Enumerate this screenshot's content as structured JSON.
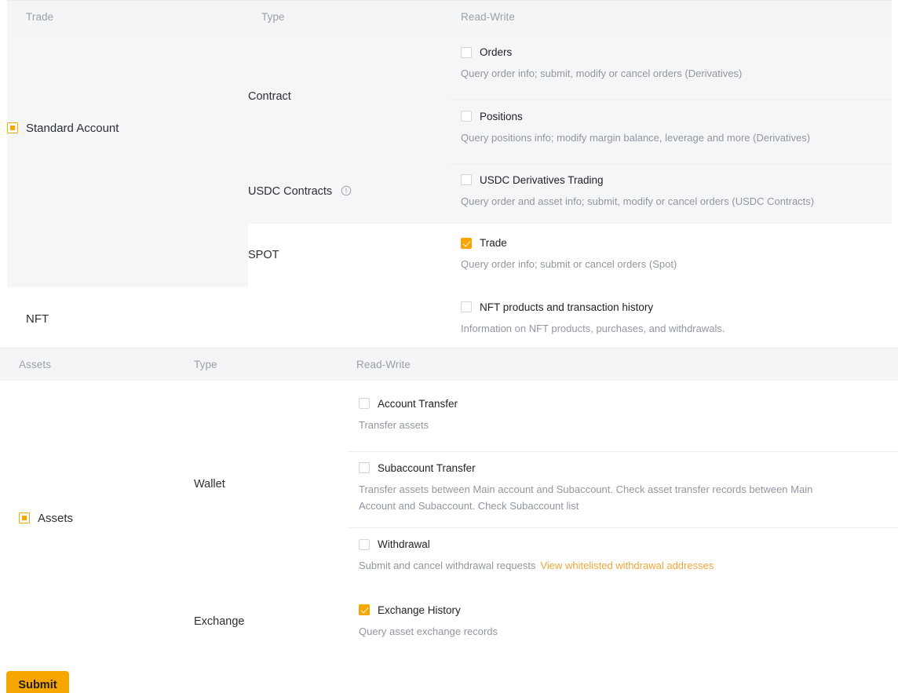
{
  "colors": {
    "accent": "#f7a600",
    "link": "#f0a53b",
    "header_bg": "#f4f5f7",
    "shaded_row_bg": "#f5f6f8",
    "border": "#edeef1",
    "label_text": "#2b2f36",
    "muted_text": "#9096a0"
  },
  "trade_table": {
    "headers": {
      "col1": "Trade",
      "col2": "Type",
      "col3": "Read-Write"
    },
    "groups": [
      {
        "name": "Standard Account",
        "checkbox_state": "indeterminate",
        "types": [
          {
            "type_label": "Contract",
            "has_info_icon": false,
            "permissions": [
              {
                "label": "Orders",
                "checked": false,
                "description": "Query order info; submit, modify or cancel orders (Derivatives)"
              },
              {
                "label": "Positions",
                "checked": false,
                "description": "Query positions info; modify margin balance, leverage and more (Derivatives)"
              }
            ]
          },
          {
            "type_label": "USDC Contracts",
            "has_info_icon": true,
            "info_icon_name": "info-circle-icon",
            "permissions": [
              {
                "label": "USDC Derivatives Trading",
                "checked": false,
                "description": "Query order and asset info; submit, modify or cancel orders (USDC Contracts)"
              }
            ]
          },
          {
            "type_label": "SPOT",
            "has_info_icon": false,
            "permissions": [
              {
                "label": "Trade",
                "checked": true,
                "description": "Query order info; submit or cancel orders (Spot)"
              }
            ]
          }
        ]
      },
      {
        "name": "NFT",
        "checkbox_state": "none",
        "types": [
          {
            "type_label": "",
            "has_info_icon": false,
            "permissions": [
              {
                "label": "NFT products and transaction history",
                "checked": false,
                "description": "Information on NFT products, purchases, and withdrawals."
              }
            ]
          }
        ]
      }
    ]
  },
  "assets_table": {
    "headers": {
      "col1": "Assets",
      "col2": "Type",
      "col3": "Read-Write"
    },
    "group": {
      "name": "Assets",
      "checkbox_state": "indeterminate"
    },
    "types": [
      {
        "type_label": "Wallet",
        "permissions": [
          {
            "label": "Account Transfer",
            "checked": false,
            "description": "Transfer assets",
            "link": ""
          },
          {
            "label": "Subaccount Transfer",
            "checked": false,
            "description": "Transfer assets between Main account and Subaccount. Check asset transfer records between Main Account and Subaccount. Check Subaccount list",
            "link": ""
          },
          {
            "label": "Withdrawal",
            "checked": false,
            "description": "Submit and cancel withdrawal requests",
            "link": "View whitelisted withdrawal addresses"
          }
        ]
      },
      {
        "type_label": "Exchange",
        "permissions": [
          {
            "label": "Exchange History",
            "checked": true,
            "description": "Query asset exchange records",
            "link": ""
          }
        ]
      }
    ]
  },
  "footer": {
    "submit_label": "Submit"
  }
}
